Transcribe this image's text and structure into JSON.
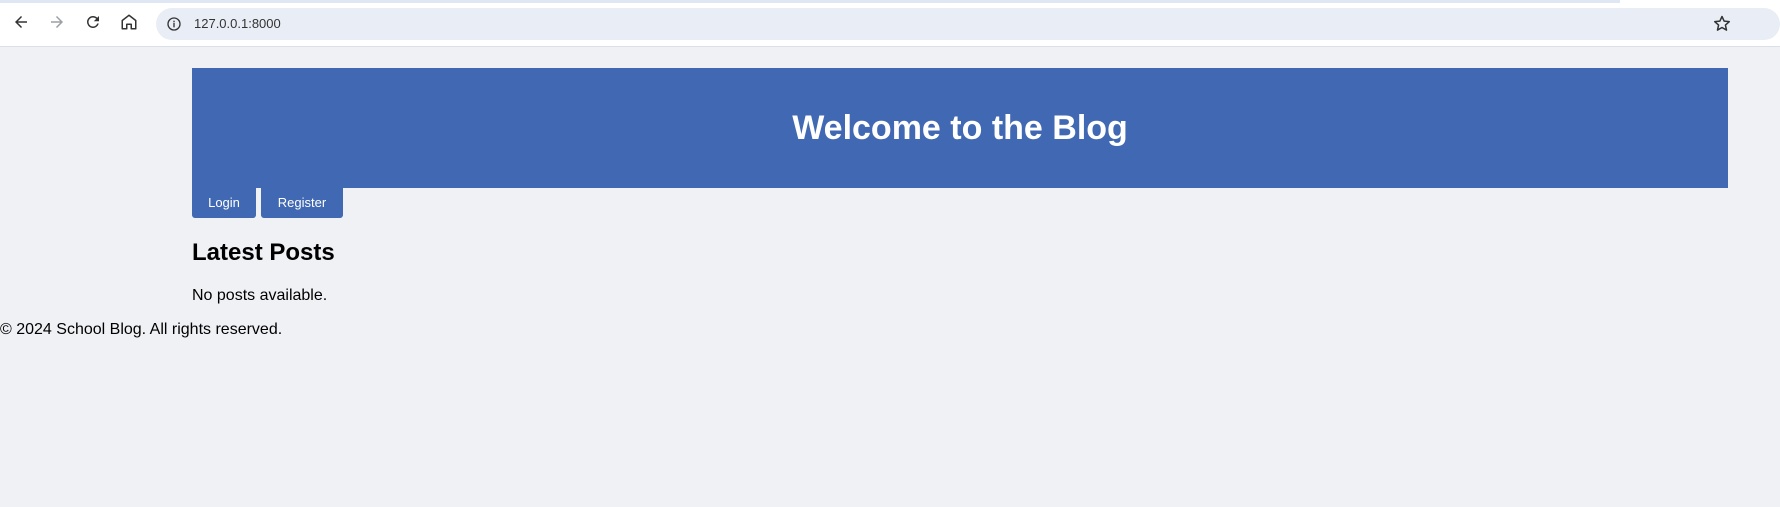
{
  "browser": {
    "url": "127.0.0.1:8000",
    "icons": {
      "back": "arrow-left-icon",
      "forward": "arrow-right-icon",
      "reload": "reload-icon",
      "home": "home-icon",
      "info": "info-icon",
      "bookmark": "star-icon"
    }
  },
  "header": {
    "title": "Welcome to the Blog"
  },
  "nav": {
    "login_label": "Login",
    "register_label": "Register"
  },
  "posts": {
    "heading": "Latest Posts",
    "empty_message": "No posts available."
  },
  "footer": {
    "text": "© 2024 School Blog. All rights reserved."
  },
  "colors": {
    "accent": "#4168b2",
    "page_background": "#f0f1f5",
    "omnibox": "#e9edf5"
  }
}
